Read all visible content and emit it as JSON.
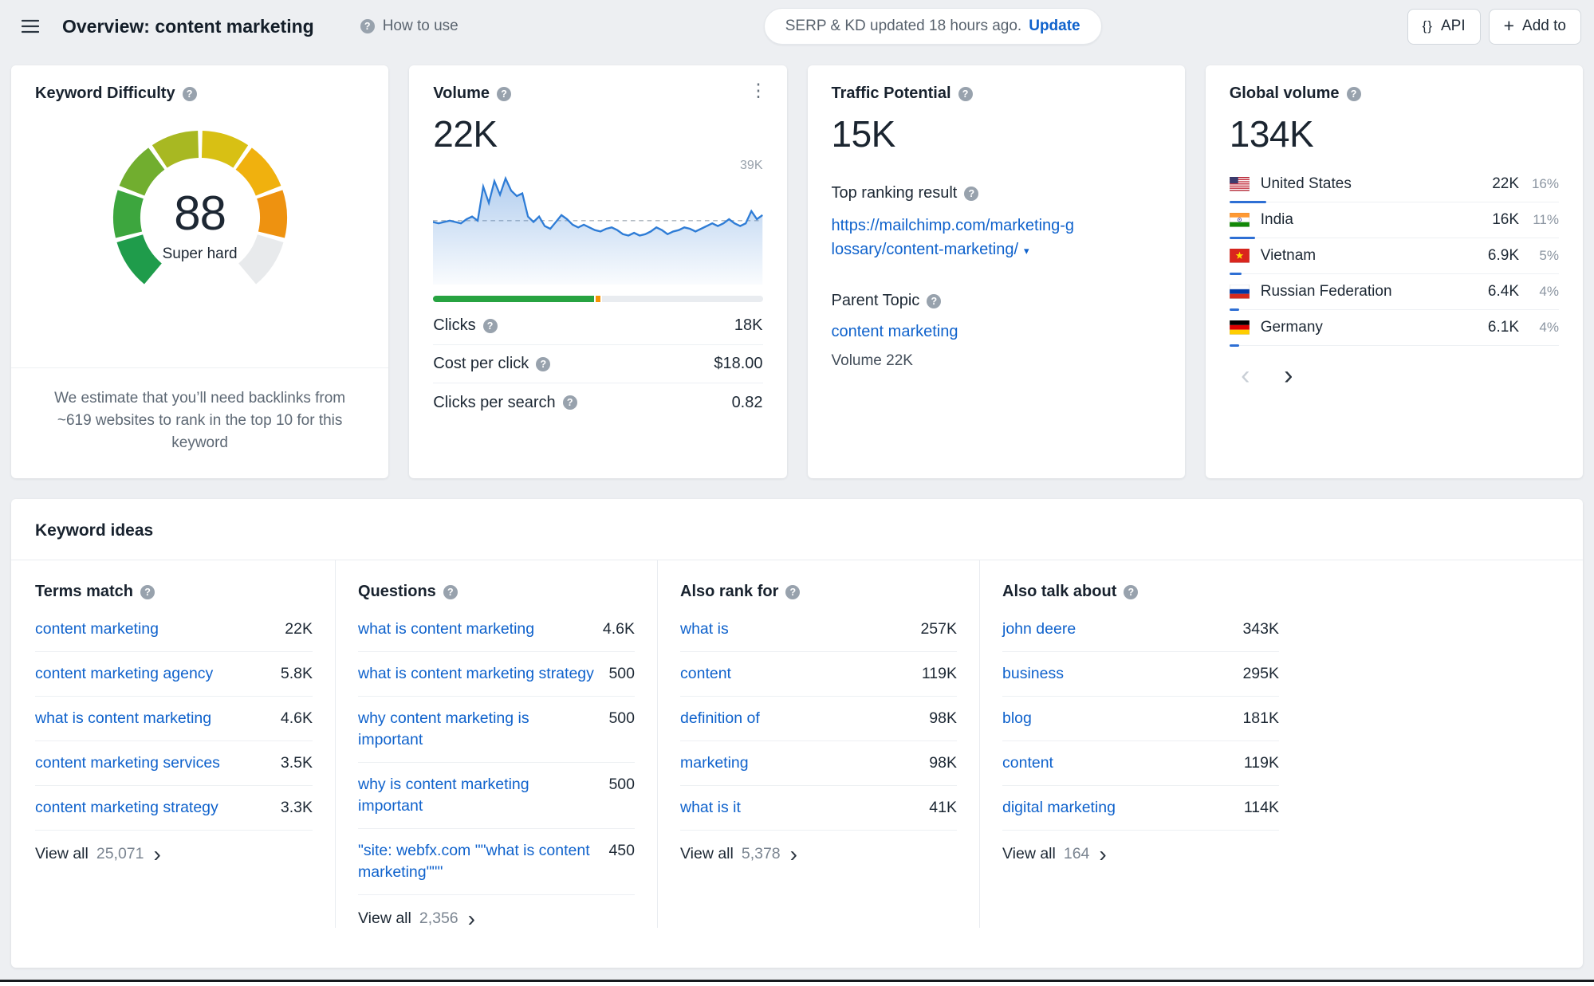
{
  "icons": {
    "question": "?",
    "kebab": "⋮",
    "caret_down": "▾",
    "chevron_right": "›",
    "chevron_left": "‹",
    "plus": "+",
    "braces": "{}"
  },
  "colors": {
    "link_blue": "#0F62CC",
    "green": "#27A341",
    "orange": "#F59305",
    "country_bar_blue": "#2E6FD4",
    "page_bg": "#EDEFF2"
  },
  "header": {
    "title": "Overview: content marketing",
    "how_to_use": "How to use",
    "update_notice": "SERP & KD updated 18 hours ago.",
    "update_action": "Update",
    "api_label": "API",
    "add_to_label": "Add to"
  },
  "keyword_difficulty": {
    "title": "Keyword Difficulty",
    "score": "88",
    "verdict": "Super hard",
    "note": "We estimate that you’ll need backlinks from ~619 websites to rank in the top 10 for this keyword"
  },
  "volume": {
    "title": "Volume",
    "value": "22K",
    "peak_label": "39K",
    "metrics": [
      {
        "label": "Clicks",
        "value": "18K"
      },
      {
        "label": "Cost per click",
        "value": "$18.00"
      },
      {
        "label": "Clicks per search",
        "value": "0.82"
      }
    ],
    "clicks_bar": [
      {
        "name": "organic-clicks",
        "style": "width:48.8%;background:#27A341"
      },
      {
        "name": "paid-clicks",
        "style": "width:1.4%;background:#F59305"
      },
      {
        "name": "no-clicks",
        "style": "flex:1;background:#E9ECF0"
      }
    ]
  },
  "traffic_potential": {
    "title": "Traffic Potential",
    "value": "15K",
    "top_ranking_label": "Top ranking result",
    "top_ranking_url": "https://mailchimp.com/marketing-g\nlossary/content-marketing/",
    "parent_topic_label": "Parent Topic",
    "parent_topic": "content marketing",
    "parent_topic_volume": "Volume 22K"
  },
  "global_volume": {
    "title": "Global volume",
    "value": "134K",
    "countries": [
      {
        "name": "United States",
        "volume": "22K",
        "percent": "16%",
        "bar_style": "width:46px"
      },
      {
        "name": "India",
        "volume": "16K",
        "percent": "11%",
        "bar_style": "width:32px"
      },
      {
        "name": "Vietnam",
        "volume": "6.9K",
        "percent": "5%",
        "bar_style": "width:15px"
      },
      {
        "name": "Russian Federation",
        "volume": "6.4K",
        "percent": "4%",
        "bar_style": "width:12px"
      },
      {
        "name": "Germany",
        "volume": "6.1K",
        "percent": "4%",
        "bar_style": "width:12px"
      }
    ]
  },
  "keyword_ideas": {
    "title": "Keyword ideas",
    "view_all_label": "View all",
    "columns": [
      {
        "title": "Terms match",
        "view_all_count": "25,071",
        "rows": [
          {
            "label": "content marketing",
            "value": "22K"
          },
          {
            "label": "content marketing agency",
            "value": "5.8K"
          },
          {
            "label": "what is content marketing",
            "value": "4.6K"
          },
          {
            "label": "content marketing services",
            "value": "3.5K"
          },
          {
            "label": "content marketing strategy",
            "value": "3.3K"
          }
        ]
      },
      {
        "title": "Questions",
        "view_all_count": "2,356",
        "rows": [
          {
            "label": "what is content marketing",
            "value": "4.6K"
          },
          {
            "label": "what is content marketing strategy",
            "value": "500"
          },
          {
            "label": "why content marketing is\nimportant",
            "value": "500"
          },
          {
            "label": "why is content marketing\nimportant",
            "value": "500"
          },
          {
            "label": "\"site: webfx.com \"\"what is content\nmarketing\"\"\"",
            "value": "450"
          }
        ]
      },
      {
        "title": "Also rank for",
        "view_all_count": "5,378",
        "rows": [
          {
            "label": "what is",
            "value": "257K"
          },
          {
            "label": "content",
            "value": "119K"
          },
          {
            "label": "definition of",
            "value": "98K"
          },
          {
            "label": "marketing",
            "value": "98K"
          },
          {
            "label": "what is it",
            "value": "41K"
          }
        ]
      },
      {
        "title": "Also talk about",
        "view_all_count": "164",
        "rows": [
          {
            "label": "john deere",
            "value": "343K"
          },
          {
            "label": "business",
            "value": "295K"
          },
          {
            "label": "blog",
            "value": "181K"
          },
          {
            "label": "content",
            "value": "119K"
          },
          {
            "label": "digital marketing",
            "value": "114K"
          }
        ]
      }
    ]
  },
  "chart_data": [
    {
      "type": "gauge",
      "title": "Keyword Difficulty",
      "value": 88,
      "max": 100,
      "label": "Super hard",
      "start_angle": 220,
      "sweep": 280,
      "stroke_width": 34,
      "segments": [
        "#1F9C4B",
        "#3DA63E",
        "#71AE2F",
        "#A8B822",
        "#D8C014",
        "#F0B10E",
        "#EE9210",
        "#E8EAEC"
      ]
    },
    {
      "type": "area",
      "title": "Volume trend",
      "ylim": [
        0,
        41
      ],
      "peak_label": "39K",
      "dashline": 23.5,
      "values": [
        23,
        22.5,
        23,
        23.5,
        23,
        22.5,
        24,
        25,
        23.5,
        36,
        30,
        38,
        33,
        39,
        34.5,
        32.5,
        33.5,
        25,
        23,
        25,
        21.5,
        20.5,
        23,
        25.5,
        24,
        22,
        21,
        22,
        21,
        20,
        19.5,
        20.5,
        21,
        20,
        18.5,
        18,
        19,
        18,
        18.5,
        19.5,
        21,
        20,
        18.5,
        19.5,
        20,
        21,
        20.5,
        19.5,
        20.5,
        21.5,
        22.5,
        21.5,
        22.5,
        24,
        22.5,
        21.5,
        22.5,
        27,
        24,
        25.5
      ]
    },
    {
      "type": "bar",
      "title": "Clicks distribution",
      "segments": [
        {
          "label": "organic",
          "pct": 48.8
        },
        {
          "label": "paid",
          "pct": 1.4
        },
        {
          "label": "no-clicks",
          "pct": 49.8
        }
      ]
    }
  ]
}
